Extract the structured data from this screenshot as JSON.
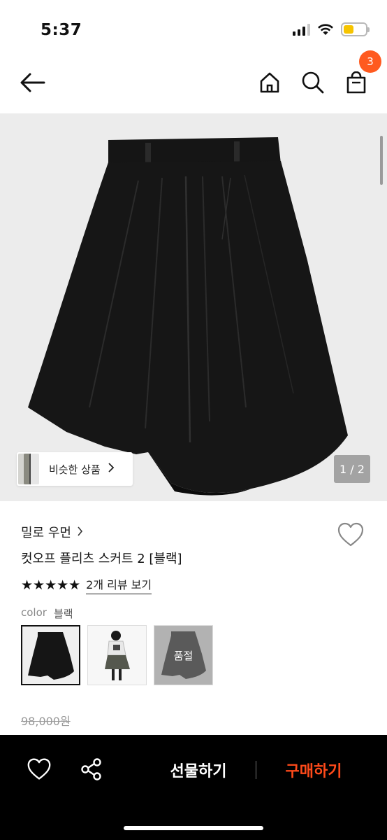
{
  "status_bar": {
    "time": "5:37"
  },
  "nav": {
    "back_icon": "arrow-left-icon",
    "home_icon": "home-icon",
    "search_icon": "search-icon",
    "cart_icon": "shopping-bag-icon",
    "cart_count": "3",
    "badge_color": "#ff5a1f"
  },
  "gallery": {
    "similar_label": "비슷한 상품",
    "page_indicator": "1 / 2"
  },
  "product": {
    "brand": "밀로 우먼",
    "name": "컷오프 플리츠 스커트 2 [블랙]",
    "rating": 5,
    "stars": "★★★★★",
    "review_link": "2개 리뷰 보기",
    "color_key": "color",
    "color_value": "블랙",
    "swatches": [
      {
        "name": "black-skirt",
        "selected": true
      },
      {
        "name": "model-look",
        "selected": false
      },
      {
        "name": "gray-skirt",
        "soldout_label": "품절"
      }
    ],
    "original_price": "98,000원"
  },
  "bottom_bar": {
    "gift_label": "선물하기",
    "buy_label": "구매하기",
    "buy_color": "#ff4a1a"
  }
}
